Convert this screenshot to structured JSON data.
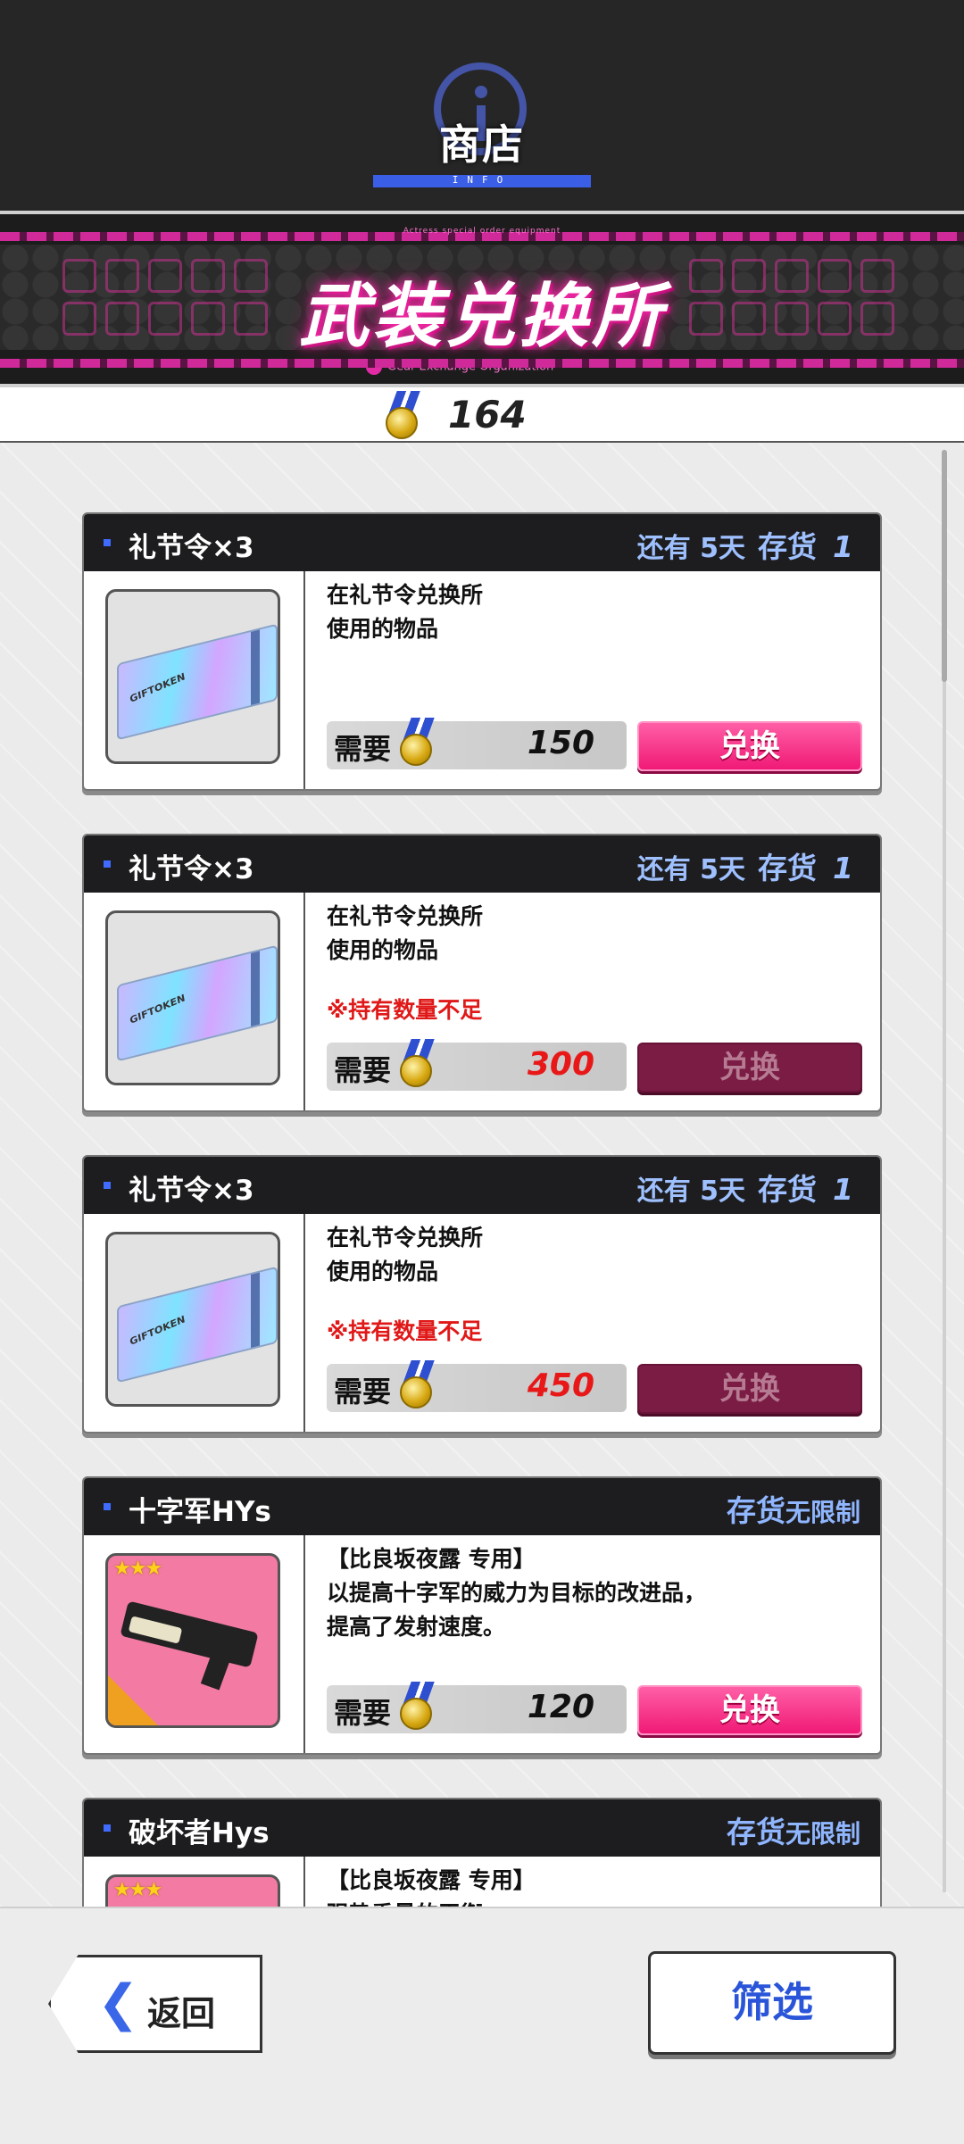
{
  "header": {
    "title": "商店",
    "info_label": "INFO"
  },
  "banner": {
    "subtitle": "Actress special order equipment",
    "title": "武装兑换所",
    "org": "Gear Exchange Organization"
  },
  "currency": {
    "icon": "medal-icon",
    "value": "164"
  },
  "items": [
    {
      "name": "礼节令×3",
      "remaining": "还有 5天",
      "stock_label": "存货",
      "stock_value": "1",
      "description": [
        "在礼节令兑换所",
        "使用的物品"
      ],
      "warning": "",
      "price_label": "需要",
      "price": "150",
      "button": "兑换",
      "enabled": true,
      "art": "gift-token",
      "art_label": "GIFTOKEN"
    },
    {
      "name": "礼节令×3",
      "remaining": "还有 5天",
      "stock_label": "存货",
      "stock_value": "1",
      "description": [
        "在礼节令兑换所",
        "使用的物品"
      ],
      "warning": "※持有数量不足",
      "price_label": "需要",
      "price": "300",
      "button": "兑换",
      "enabled": false,
      "art": "gift-token",
      "art_label": "GIFTOKEN"
    },
    {
      "name": "礼节令×3",
      "remaining": "还有 5天",
      "stock_label": "存货",
      "stock_value": "1",
      "description": [
        "在礼节令兑换所",
        "使用的物品"
      ],
      "warning": "※持有数量不足",
      "price_label": "需要",
      "price": "450",
      "button": "兑换",
      "enabled": false,
      "art": "gift-token",
      "art_label": "GIFTOKEN"
    },
    {
      "name": "十字军HYs",
      "stock_label": "存货",
      "stock_unlimited": "无限制",
      "description": [
        "【比良坂夜露 专用】",
        "以提高十字军的威力为目标的改进品，",
        "提高了发射速度。"
      ],
      "warning": "",
      "price_label": "需要",
      "price": "120",
      "button": "兑换",
      "enabled": true,
      "art": "weapon",
      "stars": "★★★"
    },
    {
      "name": "破坏者Hys",
      "stock_label": "存货",
      "stock_unlimited": "无限制",
      "description": [
        "【比良坂夜露 专用】",
        "强势重量的平衡"
      ],
      "art": "weapon",
      "stars": "★★★"
    }
  ],
  "footer": {
    "back_label": "返回",
    "filter_label": "筛选"
  },
  "colors": {
    "accent_pink": "#f01a76",
    "disabled_button": "#7a1c44",
    "warning_red": "#e01818",
    "stock_blue": "#9fc0ff",
    "header_dark": "#1d1d1f"
  }
}
